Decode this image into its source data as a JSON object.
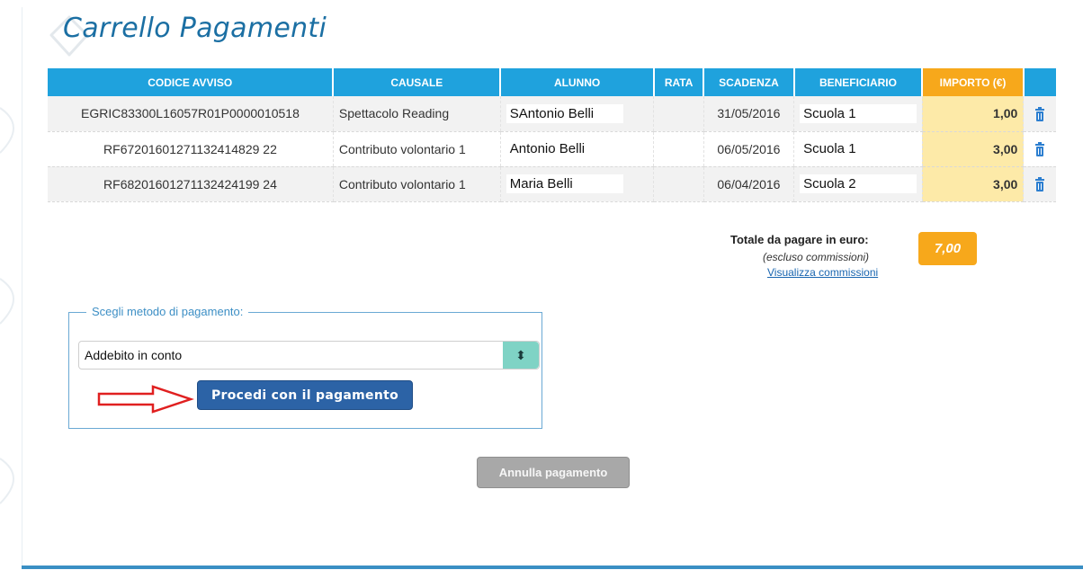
{
  "page": {
    "title": "Carrello Pagamenti"
  },
  "table": {
    "headers": [
      "CODICE AVVISO",
      "CAUSALE",
      "ALUNNO",
      "RATA",
      "SCADENZA",
      "BENEFICIARIO",
      "IMPORTO (€)"
    ],
    "rows": [
      {
        "codice": "EGRIC83300L16057R01P0000010518",
        "causale": "Spettacolo Reading",
        "alunno": "SAntonio Belli",
        "rata": "",
        "scadenza": "31/05/2016",
        "beneficiario": "Scuola 1",
        "importo": "1,00"
      },
      {
        "codice": "RF67201601271132414829 22",
        "causale": "Contributo volontario 1",
        "alunno": "Antonio Belli",
        "rata": "",
        "scadenza": "06/05/2016",
        "beneficiario": "Scuola 1",
        "importo": "3,00"
      },
      {
        "codice": "RF68201601271132424199 24",
        "causale": "Contributo volontario 1",
        "alunno": "Maria Belli",
        "rata": "",
        "scadenza": "06/04/2016",
        "beneficiario": "Scuola 2",
        "importo": "3,00"
      }
    ]
  },
  "total": {
    "label": "Totale da pagare in euro:",
    "note": "(escluso commissioni)",
    "link": "Visualizza commissioni",
    "value": "7,00"
  },
  "payment": {
    "legend": "Scegli metodo di pagamento:",
    "selected": "Addebito in conto",
    "proceed_label": "Procedi con il pagamento"
  },
  "cancel_label": "Annulla pagamento",
  "colors": {
    "header_blue": "#1fa2dd",
    "importo_orange": "#f7a81b",
    "title_blue": "#1b6fa3",
    "proceed_blue": "#2c63a6"
  }
}
